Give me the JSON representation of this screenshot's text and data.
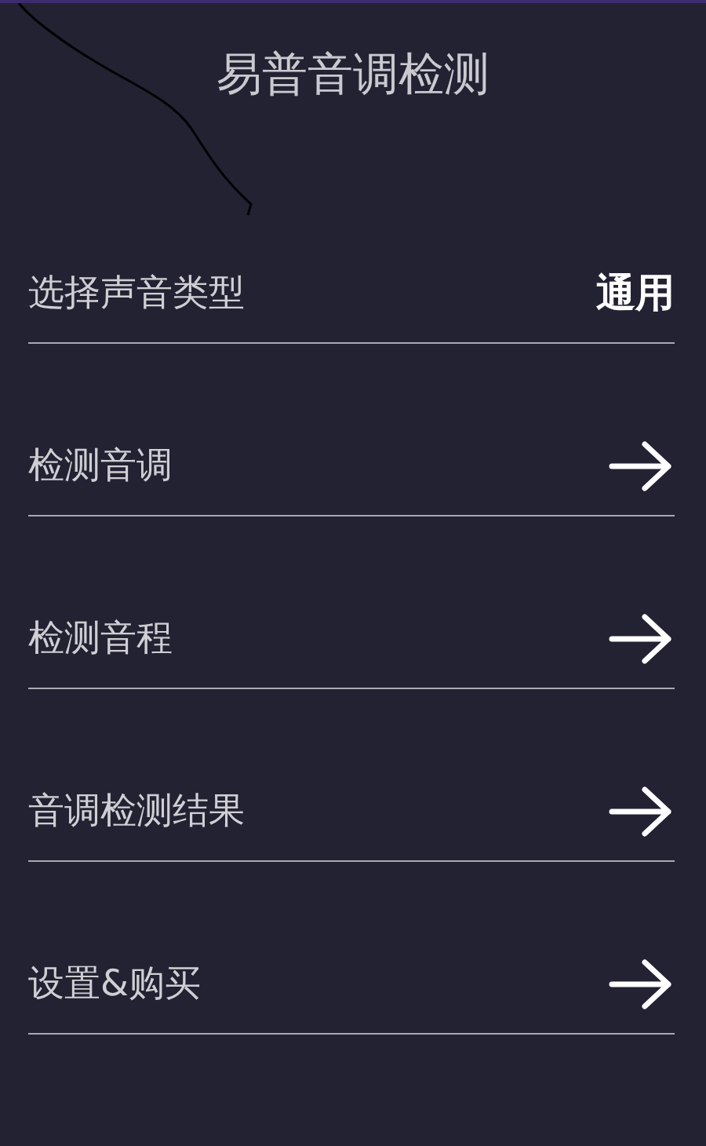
{
  "title": "易普音调检测",
  "rows": [
    {
      "kind": "value",
      "label": "选择声音类型",
      "value": "通用"
    },
    {
      "kind": "arrow",
      "label": "检测音调"
    },
    {
      "kind": "arrow",
      "label": "检测音程"
    },
    {
      "kind": "arrow",
      "label": "音调检测结果"
    },
    {
      "kind": "arrow",
      "label": "设置&购买"
    }
  ]
}
